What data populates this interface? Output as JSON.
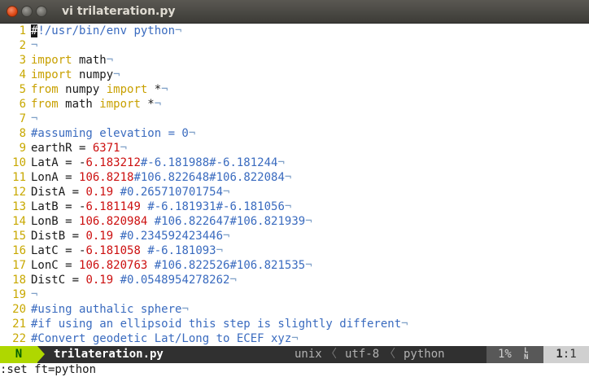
{
  "window": {
    "title": "vi trilateration.py"
  },
  "editor": {
    "lines": [
      {
        "n": "1",
        "tokens": [
          {
            "t": "cursor",
            "v": "#"
          },
          {
            "t": "comment",
            "v": "!/usr/bin/env python"
          },
          {
            "t": "nontext",
            "v": "¬"
          }
        ]
      },
      {
        "n": "2",
        "tokens": [
          {
            "t": "nontext",
            "v": "¬"
          }
        ]
      },
      {
        "n": "3",
        "tokens": [
          {
            "t": "keyword",
            "v": "import"
          },
          {
            "t": "text",
            "v": " math"
          },
          {
            "t": "nontext",
            "v": "¬"
          }
        ]
      },
      {
        "n": "4",
        "tokens": [
          {
            "t": "keyword",
            "v": "import"
          },
          {
            "t": "text",
            "v": " numpy"
          },
          {
            "t": "nontext",
            "v": "¬"
          }
        ]
      },
      {
        "n": "5",
        "tokens": [
          {
            "t": "keyword",
            "v": "from"
          },
          {
            "t": "text",
            "v": " numpy "
          },
          {
            "t": "keyword",
            "v": "import"
          },
          {
            "t": "text",
            "v": " *"
          },
          {
            "t": "nontext",
            "v": "¬"
          }
        ]
      },
      {
        "n": "6",
        "tokens": [
          {
            "t": "keyword",
            "v": "from"
          },
          {
            "t": "text",
            "v": " math "
          },
          {
            "t": "keyword",
            "v": "import"
          },
          {
            "t": "text",
            "v": " *"
          },
          {
            "t": "nontext",
            "v": "¬"
          }
        ]
      },
      {
        "n": "7",
        "tokens": [
          {
            "t": "nontext",
            "v": "¬"
          }
        ]
      },
      {
        "n": "8",
        "tokens": [
          {
            "t": "comment",
            "v": "#assuming elevation = 0"
          },
          {
            "t": "nontext",
            "v": "¬"
          }
        ]
      },
      {
        "n": "9",
        "tokens": [
          {
            "t": "text",
            "v": "earthR = "
          },
          {
            "t": "number",
            "v": "6371"
          },
          {
            "t": "nontext",
            "v": "¬"
          }
        ]
      },
      {
        "n": "10",
        "tokens": [
          {
            "t": "text",
            "v": "LatA = -"
          },
          {
            "t": "number",
            "v": "6.183212"
          },
          {
            "t": "comment",
            "v": "#-6.181988#-6.181244"
          },
          {
            "t": "nontext",
            "v": "¬"
          }
        ]
      },
      {
        "n": "11",
        "tokens": [
          {
            "t": "text",
            "v": "LonA = "
          },
          {
            "t": "number",
            "v": "106.8218"
          },
          {
            "t": "comment",
            "v": "#106.822648#106.822084"
          },
          {
            "t": "nontext",
            "v": "¬"
          }
        ]
      },
      {
        "n": "12",
        "tokens": [
          {
            "t": "text",
            "v": "DistA = "
          },
          {
            "t": "number",
            "v": "0.19"
          },
          {
            "t": "text",
            "v": " "
          },
          {
            "t": "comment",
            "v": "#0.265710701754"
          },
          {
            "t": "nontext",
            "v": "¬"
          }
        ]
      },
      {
        "n": "13",
        "tokens": [
          {
            "t": "text",
            "v": "LatB = -"
          },
          {
            "t": "number",
            "v": "6.181149"
          },
          {
            "t": "text",
            "v": " "
          },
          {
            "t": "comment",
            "v": "#-6.181931#-6.181056"
          },
          {
            "t": "nontext",
            "v": "¬"
          }
        ]
      },
      {
        "n": "14",
        "tokens": [
          {
            "t": "text",
            "v": "LonB = "
          },
          {
            "t": "number",
            "v": "106.820984"
          },
          {
            "t": "text",
            "v": " "
          },
          {
            "t": "comment",
            "v": "#106.822647#106.821939"
          },
          {
            "t": "nontext",
            "v": "¬"
          }
        ]
      },
      {
        "n": "15",
        "tokens": [
          {
            "t": "text",
            "v": "DistB = "
          },
          {
            "t": "number",
            "v": "0.19"
          },
          {
            "t": "text",
            "v": " "
          },
          {
            "t": "comment",
            "v": "#0.234592423446"
          },
          {
            "t": "nontext",
            "v": "¬"
          }
        ]
      },
      {
        "n": "16",
        "tokens": [
          {
            "t": "text",
            "v": "LatC = -"
          },
          {
            "t": "number",
            "v": "6.181058"
          },
          {
            "t": "text",
            "v": " "
          },
          {
            "t": "comment",
            "v": "#-6.181093"
          },
          {
            "t": "nontext",
            "v": "¬"
          }
        ]
      },
      {
        "n": "17",
        "tokens": [
          {
            "t": "text",
            "v": "LonC = "
          },
          {
            "t": "number",
            "v": "106.820763"
          },
          {
            "t": "text",
            "v": " "
          },
          {
            "t": "comment",
            "v": "#106.822526#106.821535"
          },
          {
            "t": "nontext",
            "v": "¬"
          }
        ]
      },
      {
        "n": "18",
        "tokens": [
          {
            "t": "text",
            "v": "DistC = "
          },
          {
            "t": "number",
            "v": "0.19"
          },
          {
            "t": "text",
            "v": " "
          },
          {
            "t": "comment",
            "v": "#0.0548954278262"
          },
          {
            "t": "nontext",
            "v": "¬"
          }
        ]
      },
      {
        "n": "19",
        "tokens": [
          {
            "t": "nontext",
            "v": "¬"
          }
        ]
      },
      {
        "n": "20",
        "tokens": [
          {
            "t": "comment",
            "v": "#using authalic sphere"
          },
          {
            "t": "nontext",
            "v": "¬"
          }
        ]
      },
      {
        "n": "21",
        "tokens": [
          {
            "t": "comment",
            "v": "#if using an ellipsoid this step is slightly different"
          },
          {
            "t": "nontext",
            "v": "¬"
          }
        ]
      },
      {
        "n": "22",
        "tokens": [
          {
            "t": "comment",
            "v": "#Convert geodetic Lat/Long to ECEF xyz"
          },
          {
            "t": "nontext",
            "v": "¬"
          }
        ]
      }
    ]
  },
  "statusline": {
    "mode": "N",
    "filename": "trilateration.py",
    "fileformat": "unix",
    "encoding": "utf-8",
    "filetype": "python",
    "percent": "1%",
    "ln_icon_top": "L",
    "ln_icon_bottom": "N",
    "line": "1",
    "col_sep": ":",
    "col": "1",
    "separator": "〈"
  },
  "cmdline": {
    "text": ":set ft=python"
  },
  "colors": {
    "mode_bg": "#afd700",
    "comment": "#3a6bbf",
    "keyword": "#c8a000",
    "number": "#cc1010",
    "line_number": "#c8a800"
  }
}
